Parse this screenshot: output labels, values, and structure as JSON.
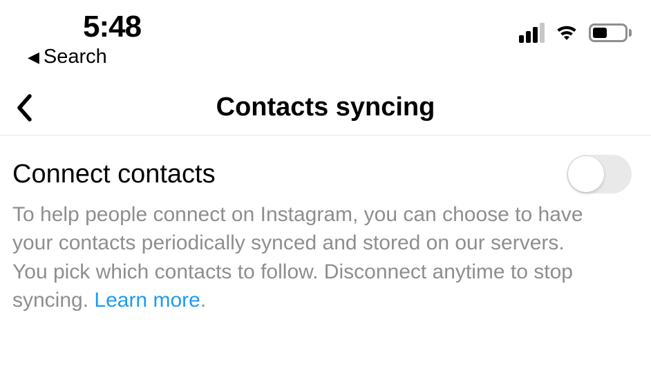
{
  "status": {
    "time": "5:48",
    "breadcrumb": "Search"
  },
  "nav": {
    "title": "Contacts syncing"
  },
  "setting": {
    "title": "Connect contacts",
    "description": "To help people connect on Instagram, you can choose to have your contacts periodically synced and stored on our servers. You pick which contacts to follow. Disconnect anytime to stop syncing. ",
    "learn_more": "Learn more",
    "period": ".",
    "toggle_on": false
  }
}
